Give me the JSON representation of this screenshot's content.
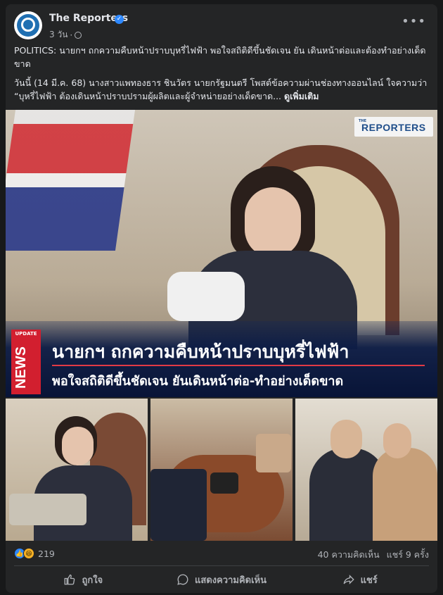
{
  "post": {
    "page_name": "The Reporters",
    "time": "3 วัน",
    "separator": "·",
    "more": "•••",
    "text_line1": "POLITICS: นายกฯ ถกความคืบหน้าปราบบุหรี่ไฟฟ้า พอใจสถิติดีขึ้นชัดเจน ยัน เดินหน้าต่อและต้องทำอย่างเด็ดขาด",
    "text_line2": "วันนี้ (14 มี.ค. 68) นางสาวแพทองธาร ชินวัตร นายกรัฐมนตรี โพสต์ข้อความผ่านช่องทางออนไลน์ ใจความว่า “บุหรี่ไฟฟ้า ต้องเดินหน้าปราบปรามผู้ผลิตและผู้จำหน่ายอย่างเด็ดขาด...",
    "see_more": "ดูเพิ่มเติม"
  },
  "image": {
    "logo_the": "THE",
    "logo_text": "REPORTERS",
    "badge_update": "UPDATE",
    "badge_news": "NEWS",
    "headline1": "นายกฯ ถกความคืบหน้าปราบบุหรี่ไฟฟ้า",
    "headline2": "พอใจสถิติดีขึ้นชัดเจน ยันเดินหน้าต่อ-ทำอย่างเด็ดขาด",
    "accent_color": "#d21f2f"
  },
  "stats": {
    "reactions": "219",
    "comments": "40 ความคิดเห็น",
    "shares": "แชร์ 9 ครั้ง"
  },
  "actions": {
    "like": "ถูกใจ",
    "comment": "แสดงความคิดเห็น",
    "share": "แชร์"
  }
}
